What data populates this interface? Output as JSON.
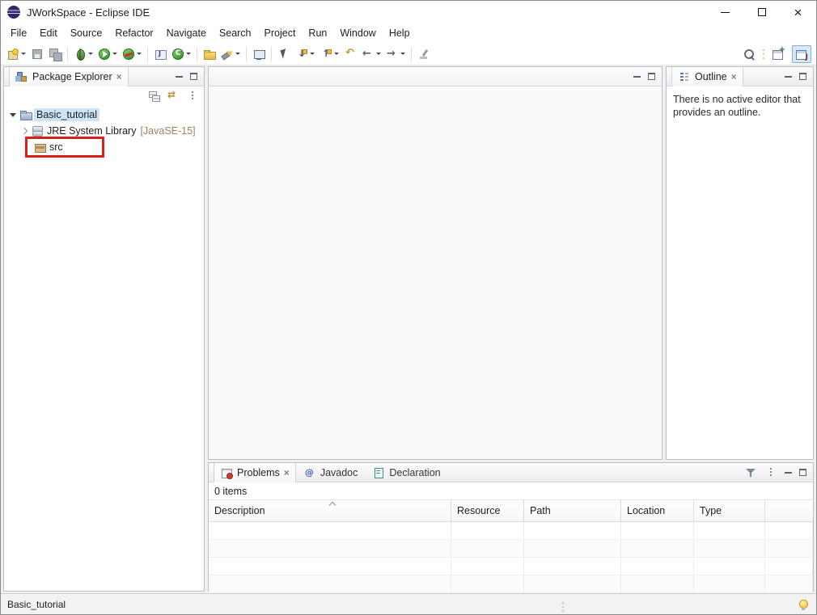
{
  "window": {
    "title": "JWorkSpace - Eclipse IDE"
  },
  "menubar": {
    "items": [
      "File",
      "Edit",
      "Source",
      "Refactor",
      "Navigate",
      "Search",
      "Project",
      "Run",
      "Window",
      "Help"
    ]
  },
  "toolbar": {
    "buttons": [
      "new-wizard",
      "save",
      "save-all",
      "debug",
      "run",
      "coverage",
      "new-java-project",
      "new-java-class",
      "open-task",
      "search-tool",
      "open-console",
      "selection-tool",
      "next-annotation",
      "previous-annotation",
      "last-edit-location",
      "back",
      "forward",
      "pin-editor"
    ],
    "right_buttons": [
      "search",
      "open-perspective",
      "java-perspective"
    ]
  },
  "package_explorer": {
    "tab": "Package Explorer",
    "toolbar_icons": [
      "collapse-all",
      "link-with-editor",
      "view-menu"
    ],
    "tree": [
      {
        "label": "Basic_tutorial",
        "type": "java-project",
        "expanded": true,
        "selected": true
      },
      {
        "label": "JRE System Library",
        "decoration": "[JavaSE-15]",
        "type": "library",
        "collapsed": true
      },
      {
        "label": "src",
        "type": "source-folder",
        "annotated": true
      }
    ]
  },
  "outline": {
    "tab": "Outline",
    "message": "There is no active editor that provides an outline."
  },
  "problems_view": {
    "tabs": [
      "Problems",
      "Javadoc",
      "Declaration"
    ],
    "active_tab": "Problems",
    "summary": "0 items",
    "columns": [
      "Description",
      "Resource",
      "Path",
      "Location",
      "Type"
    ],
    "rows": []
  },
  "statusbar": {
    "selection": "Basic_tutorial"
  },
  "annotation": {
    "shape": "rectangle",
    "color": "#d8201a",
    "target": "src tree item"
  },
  "colors": {
    "tree_selection_bg": "#cbe4f6",
    "decoration_text": "#9a8460",
    "panel_border": "#b9bfc8"
  }
}
